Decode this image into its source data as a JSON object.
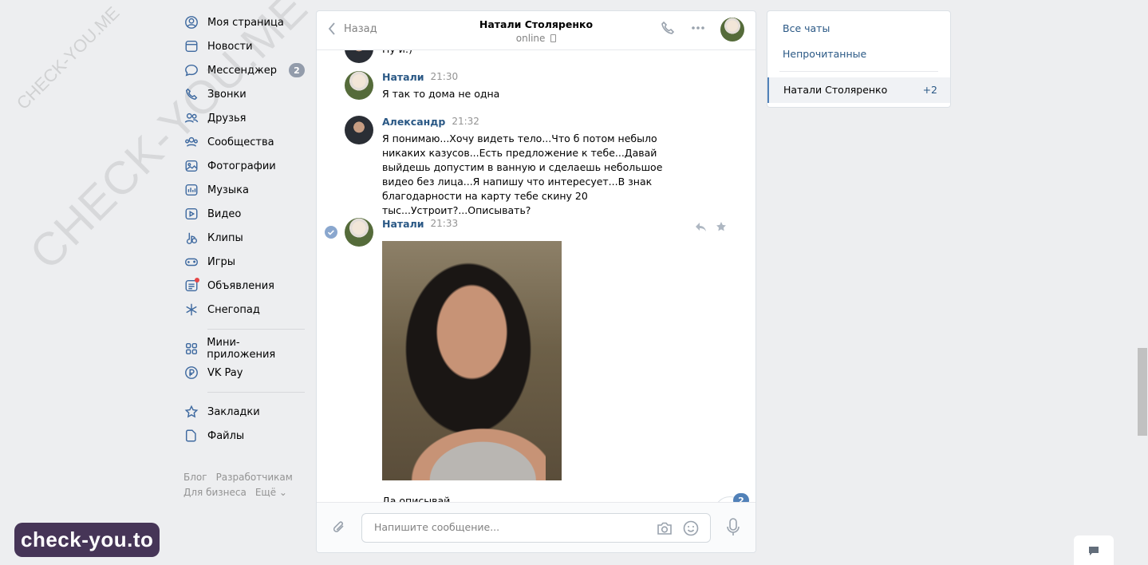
{
  "watermark": {
    "diagonal": "CHECK-YOU.ME",
    "small": "CHECK-YOU.ME",
    "brand": "check-you.to"
  },
  "nav": {
    "items": [
      {
        "label": "Моя страница",
        "icon": "user-circle-icon"
      },
      {
        "label": "Новости",
        "icon": "news-icon"
      },
      {
        "label": "Мессенджер",
        "icon": "messenger-icon",
        "badge": "2"
      },
      {
        "label": "Звонки",
        "icon": "phone-icon"
      },
      {
        "label": "Друзья",
        "icon": "friends-icon"
      },
      {
        "label": "Сообщества",
        "icon": "communities-icon"
      },
      {
        "label": "Фотографии",
        "icon": "photos-icon"
      },
      {
        "label": "Музыка",
        "icon": "music-icon"
      },
      {
        "label": "Видео",
        "icon": "video-icon"
      },
      {
        "label": "Клипы",
        "icon": "clips-icon"
      },
      {
        "label": "Игры",
        "icon": "games-icon"
      },
      {
        "label": "Объявления",
        "icon": "ads-icon"
      },
      {
        "label": "Снегопад",
        "icon": "snowflake-icon"
      }
    ],
    "items2": [
      {
        "label": "Мини-приложения",
        "icon": "mini-apps-icon"
      },
      {
        "label": "VK Pay",
        "icon": "vkpay-icon"
      }
    ],
    "items3": [
      {
        "label": "Закладки",
        "icon": "bookmark-icon"
      },
      {
        "label": "Файлы",
        "icon": "files-icon"
      }
    ],
    "footer": {
      "blog": "Блог",
      "dev": "Разработчикам",
      "business": "Для бизнеса",
      "more": "Ещё ⌄"
    }
  },
  "chat": {
    "back_label": "Назад",
    "name": "Натали Столяренко",
    "status": "online",
    "partial_text": "Ну и:)",
    "messages": [
      {
        "author": "Натали",
        "time": "21:30",
        "text": "Я так то дома не одна"
      },
      {
        "author": "Александр",
        "time": "21:32",
        "text": "Я понимаю...Хочу видеть тело...Что б потом небыло никаких казусов...Есть предложение к тебе...Давай выйдешь допустим в ванную и сделаешь небольшое видео без лица...Я напишу что интересует...В знак благодарности на карту тебе скину 20 тыс...Устроит?...Описывать?"
      },
      {
        "author": "Натали",
        "time": "21:33",
        "text": "Да описывай"
      }
    ],
    "unread_badge": "2",
    "composer_placeholder": "Напишите сообщение..."
  },
  "right_panel": {
    "all_chats": "Все чаты",
    "unread": "Непрочитанные",
    "active_name": "Натали Столяренко",
    "active_count": "+2"
  },
  "colors": {
    "accent": "#2a5885",
    "icon": "#3f6aa0",
    "badge": "#939cab",
    "blue_badge": "#5181b8"
  }
}
